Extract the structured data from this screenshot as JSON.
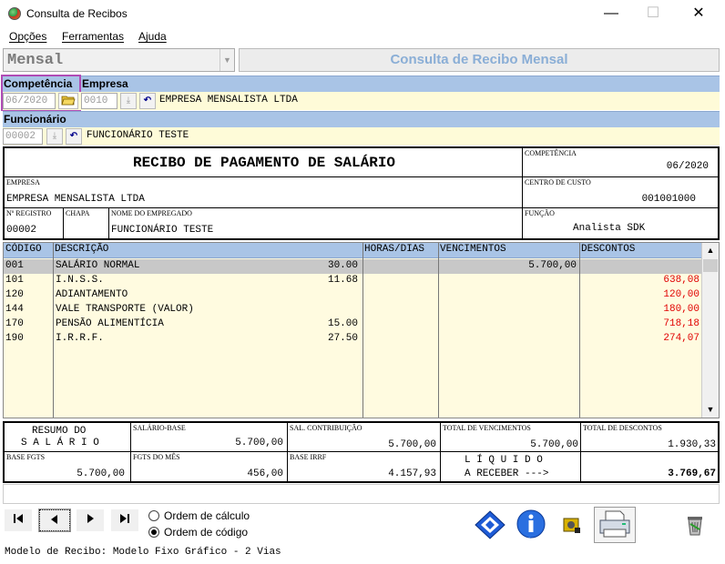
{
  "window": {
    "title": "Consulta de Recibos",
    "minimize": "—",
    "maximize": "☐",
    "close": "✕"
  },
  "menu": [
    "Opções",
    "Ferramentas",
    "Ajuda"
  ],
  "mode": {
    "value": "Mensal",
    "panel_title": "Consulta de Recibo Mensal"
  },
  "filters": {
    "competencia_label": "Competência",
    "empresa_label": "Empresa",
    "competencia_value": "06/2020",
    "empresa_code": "0010",
    "empresa_name": "EMPRESA MENSALISTA LTDA",
    "funcionario_label": "Funcionário",
    "funcionario_code": "00002",
    "funcionario_name": "FUNCIONÁRIO TESTE"
  },
  "receipt": {
    "title": "RECIBO DE PAGAMENTO DE SALÁRIO",
    "competencia_label": "COMPETÊNCIA",
    "competencia_value": "06/2020",
    "empresa_label": "EMPRESA",
    "empresa_value": "EMPRESA MENSALISTA LTDA",
    "centro_label": "CENTRO DE CUSTO",
    "centro_value": "001001000",
    "registro_label": "Nº REGISTRO",
    "registro_value": "00002",
    "chapa_label": "CHAPA",
    "nome_label": "NOME DO EMPREGADO",
    "nome_value": "FUNCIONÁRIO TESTE",
    "funcao_label": "FUNÇÃO",
    "funcao_value": "Analista SDK"
  },
  "grid": {
    "headers": {
      "codigo": "CÓDIGO",
      "descricao": "DESCRIÇÃO",
      "horas": "HORAS/DIAS",
      "vencimentos": "VENCIMENTOS",
      "descontos": "DESCONTOS"
    },
    "rows": [
      {
        "codigo": "001",
        "descricao": "SALÁRIO NORMAL",
        "horas": "30.00",
        "vencimentos": "5.700,00",
        "descontos": ""
      },
      {
        "codigo": "101",
        "descricao": "I.N.S.S.",
        "horas": "11.68",
        "vencimentos": "",
        "descontos": "638,08"
      },
      {
        "codigo": "120",
        "descricao": "ADIANTAMENTO",
        "horas": "",
        "vencimentos": "",
        "descontos": "120,00"
      },
      {
        "codigo": "144",
        "descricao": "VALE TRANSPORTE (VALOR)",
        "horas": "",
        "vencimentos": "",
        "descontos": "180,00"
      },
      {
        "codigo": "170",
        "descricao": "PENSÃO ALIMENTÍCIA",
        "horas": "15.00",
        "vencimentos": "",
        "descontos": "718,18"
      },
      {
        "codigo": "190",
        "descricao": "I.R.R.F.",
        "horas": "27.50",
        "vencimentos": "",
        "descontos": "274,07"
      }
    ],
    "discount_color": "#e00000",
    "selected_color": "#c8c8c8"
  },
  "summary": {
    "resumo_line1": "RESUMO DO",
    "resumo_line2": "S A L Á R I O",
    "salario_base_label": "SALÁRIO-BASE",
    "salario_base_value": "5.700,00",
    "sal_contrib_label": "SAL. CONTRIBUIÇÃO",
    "sal_contrib_value": "5.700,00",
    "total_venc_label": "TOTAL DE VENCIMENTOS",
    "total_venc_value": "5.700,00",
    "total_desc_label": "TOTAL DE DESCONTOS",
    "total_desc_value": "1.930,33",
    "base_fgts_label": "BASE FGTS",
    "base_fgts_value": "5.700,00",
    "fgts_mes_label": "FGTS DO MÊS",
    "fgts_mes_value": "456,00",
    "base_irrf_label": "BASE IRRF",
    "base_irrf_value": "4.157,93",
    "liquido_line1": "L Í Q U I D O",
    "liquido_line2": "A RECEBER --->",
    "liquido_value": "3.769,67"
  },
  "order": {
    "calc_label": "Ordem de cálculo",
    "code_label": "Ordem de código",
    "selected": "code"
  },
  "status": "Modelo de Recibo: Modelo Fixo Gráfico - 2 Vias"
}
